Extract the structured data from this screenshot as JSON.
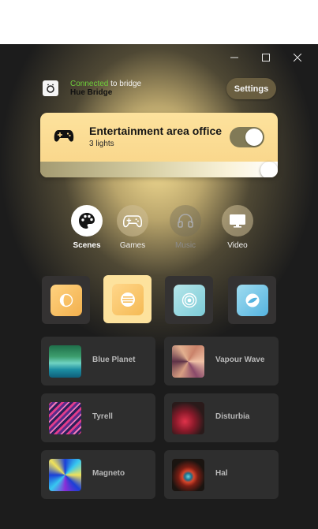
{
  "window": {
    "controls": [
      "minimize",
      "maximize",
      "close"
    ]
  },
  "bridge": {
    "status_connected": "Connected",
    "status_rest": "to bridge",
    "name": "Hue Bridge",
    "icon": "bridge-icon"
  },
  "settings_button": "Settings",
  "entertainment": {
    "title": "Entertainment area office",
    "subtitle": "3 lights",
    "toggle_on": true,
    "brightness": 1.0
  },
  "tabs": [
    {
      "label": "Scenes",
      "icon": "palette-icon",
      "state": "active"
    },
    {
      "label": "Games",
      "icon": "gamepad-icon",
      "state": "normal"
    },
    {
      "label": "Music",
      "icon": "headphones-icon",
      "state": "dim"
    },
    {
      "label": "Video",
      "icon": "monitor-icon",
      "state": "normal"
    }
  ],
  "sync_styles": [
    {
      "icon": "subtle-style-icon",
      "color": "#f5c45e",
      "active": false
    },
    {
      "icon": "moderate-style-icon",
      "color": "#ffffff",
      "active": true
    },
    {
      "icon": "high-style-icon",
      "color": "#8ed3de",
      "active": false
    },
    {
      "icon": "intense-style-icon",
      "color": "#6fc2e3",
      "active": false
    }
  ],
  "scenes": [
    {
      "label": "Blue Planet"
    },
    {
      "label": "Vapour Wave"
    },
    {
      "label": "Tyrell"
    },
    {
      "label": "Disturbia"
    },
    {
      "label": "Magneto"
    },
    {
      "label": "Hal"
    }
  ]
}
